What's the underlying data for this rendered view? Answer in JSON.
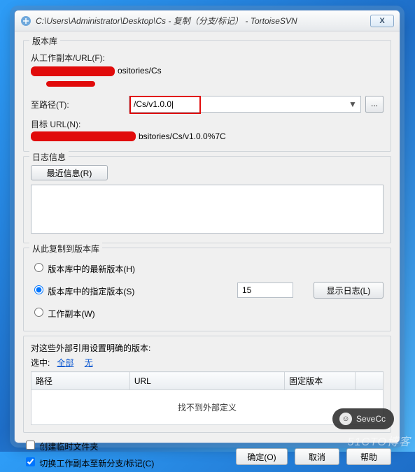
{
  "window": {
    "title": "C:\\Users\\Administrator\\Desktop\\Cs - 复制（分支/标记） - TortoiseSVN"
  },
  "repo": {
    "legend": "版本库",
    "from_label": "从工作副本/URL(F):",
    "from_suffix": "ositories/Cs",
    "to_label": "至路径(T):",
    "to_value": "/Cs/v1.0.0|",
    "target_label": "目标 URL(N):",
    "target_suffix": "bsitories/Cs/v1.0.0%7C",
    "browse": "..."
  },
  "log": {
    "legend": "日志信息",
    "recent_btn": "最近信息(R)",
    "text": ""
  },
  "copyfrom": {
    "legend": "从此复制到版本库",
    "opt_head": "版本库中的最新版本(H)",
    "opt_rev": "版本库中的指定版本(S)",
    "opt_wc": "工作副本(W)",
    "rev_value": "15",
    "showlog_btn": "显示日志(L)"
  },
  "externals": {
    "title": "对这些外部引用设置明确的版本:",
    "sel_label": "选中:",
    "sel_all": "全部",
    "sel_none": "无",
    "col_path": "路径",
    "col_url": "URL",
    "col_peg": "固定版本",
    "empty": "找不到外部定义"
  },
  "footer": {
    "chk_intermediate": "创建临时文件夹",
    "chk_switch": "切换工作副本至新分支/标记(C)",
    "ok": "确定(O)",
    "cancel": "取消",
    "help": "帮助"
  },
  "overlay": {
    "bubble": "SeveCc",
    "watermark": "51CTO博客"
  }
}
